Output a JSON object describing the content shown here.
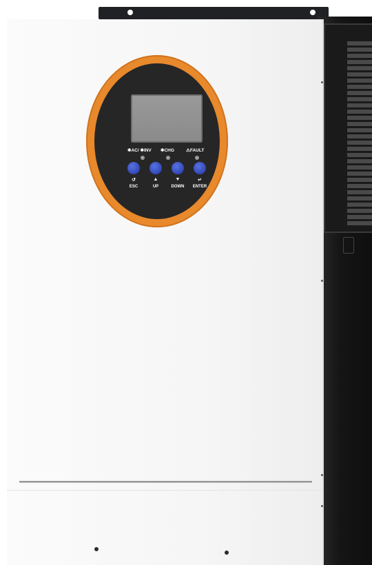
{
  "panel": {
    "indicators": [
      {
        "symbol": "✱",
        "label": "AC/",
        "symbol2": "✱",
        "label2": "INV"
      },
      {
        "symbol": "✱",
        "label": "CHG"
      },
      {
        "symbol": "⚠",
        "label": "FAULT"
      }
    ],
    "buttons": [
      {
        "symbol": "↺",
        "label": "ESC"
      },
      {
        "symbol": "▲",
        "label": "UP"
      },
      {
        "symbol": "▼",
        "label": "DOWN"
      },
      {
        "symbol": "↵",
        "label": "ENTER"
      }
    ]
  },
  "colors": {
    "ring": "#e8892c",
    "face": "#262626",
    "button": "#3f57cf",
    "body": "#f6f6f6",
    "side": "#151515"
  }
}
